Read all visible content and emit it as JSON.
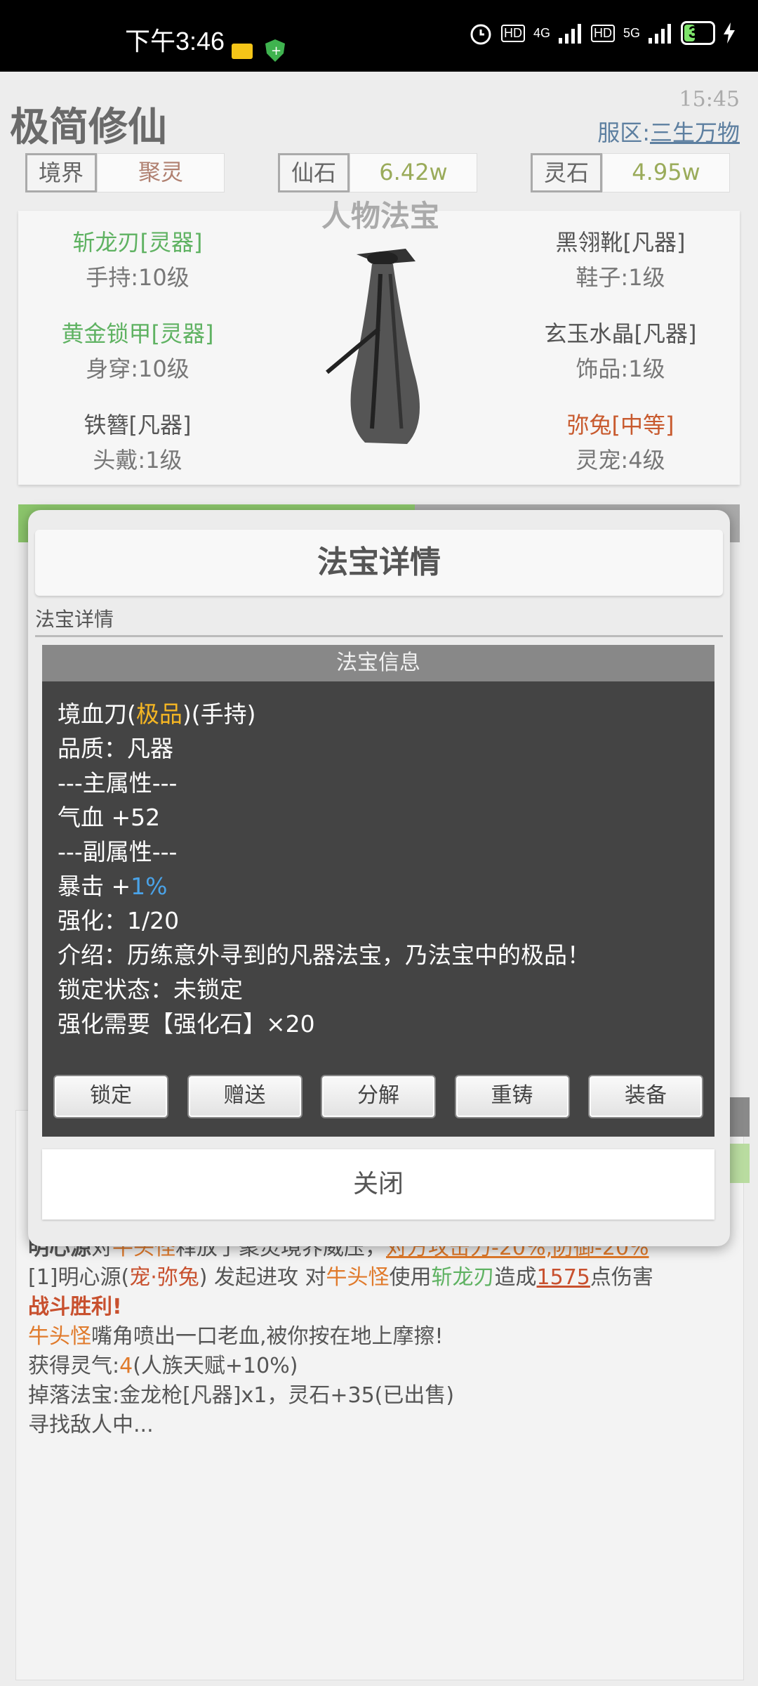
{
  "status_bar": {
    "time": "下午3:46",
    "net1": "4G",
    "net2": "5G",
    "hd": "HD",
    "battery": "33"
  },
  "header": {
    "title": "极简修仙",
    "clock": "15:45",
    "server_prefix": "服区:",
    "server_name": "三生万物"
  },
  "resources": [
    {
      "label": "境界",
      "value": "聚灵",
      "color": "#b08070"
    },
    {
      "label": "仙石",
      "value": "6.42w",
      "color": "#9aab5a"
    },
    {
      "label": "灵石",
      "value": "4.95w",
      "color": "#9aab5a"
    }
  ],
  "equipment": {
    "title": "人物法宝",
    "slots": [
      {
        "name": "斩龙刃[灵器]",
        "sub": "手持:10级"
      },
      {
        "name": "黄金锁甲[灵器]",
        "sub": "身穿:10级"
      },
      {
        "name": "铁簪[凡器]",
        "sub": "头戴:1级"
      },
      {
        "name": "黑翎靴[凡器]",
        "sub": "鞋子:1级"
      },
      {
        "name": "玄玉水晶[凡器]",
        "sub": "饰品:1级"
      },
      {
        "name": "弥兔[中等]",
        "sub": "灵宠:4级"
      }
    ]
  },
  "modal": {
    "title": "法宝详情",
    "tab": "法宝详情",
    "info_header": "法宝信息",
    "item_name": "境血刀(",
    "item_grade": "极品",
    "item_slot": ")(手持)",
    "quality": "品质：凡器",
    "main_attr_header": "---主属性---",
    "main_attr_label": "气血 ",
    "main_attr_value": "+52",
    "sub_attr_header": "---副属性---",
    "sub_attr_label": "暴击 +",
    "sub_attr_value": "1%",
    "enhance": "强化：1/20",
    "intro": "介绍：历练意外寻到的凡器法宝，乃法宝中的极品！",
    "lock_status": "锁定状态：未锁定",
    "enhance_need": "强化需要【强化石】×20",
    "buttons": {
      "lock": "锁定",
      "gift": "赠送",
      "decompose": "分解",
      "recast": "重铸",
      "equip": "装备"
    },
    "close": "关闭"
  },
  "log": {
    "l1_a": "明心源",
    "l1_b": "对",
    "l1_c": "牛头怪",
    "l1_d": "释放了聚灵境界威压，",
    "l1_e": "对方攻击力-20%,防御-20%",
    "l2_a": "[1]",
    "l2_b": "明心源",
    "l2_c": "(",
    "l2_d": "宠·弥兔",
    "l2_e": ") 发起进攻 对",
    "l2_f": "牛头怪",
    "l2_g": "使用",
    "l2_h": "斩龙刃",
    "l2_i": "造成",
    "l2_j": "1575",
    "l2_k": "点伤害",
    "l3": "战斗胜利!",
    "l4_a": "牛头怪",
    "l4_b": "嘴角喷出一口老血,被你按在地上摩擦!",
    "l5_a": "获得灵气:",
    "l5_b": "4",
    "l5_c": "(人族天赋+10%)",
    "l6": "掉落法宝:金龙枪[凡器]x1，灵石+35(已出售)",
    "l7": "寻找敌人中..."
  }
}
